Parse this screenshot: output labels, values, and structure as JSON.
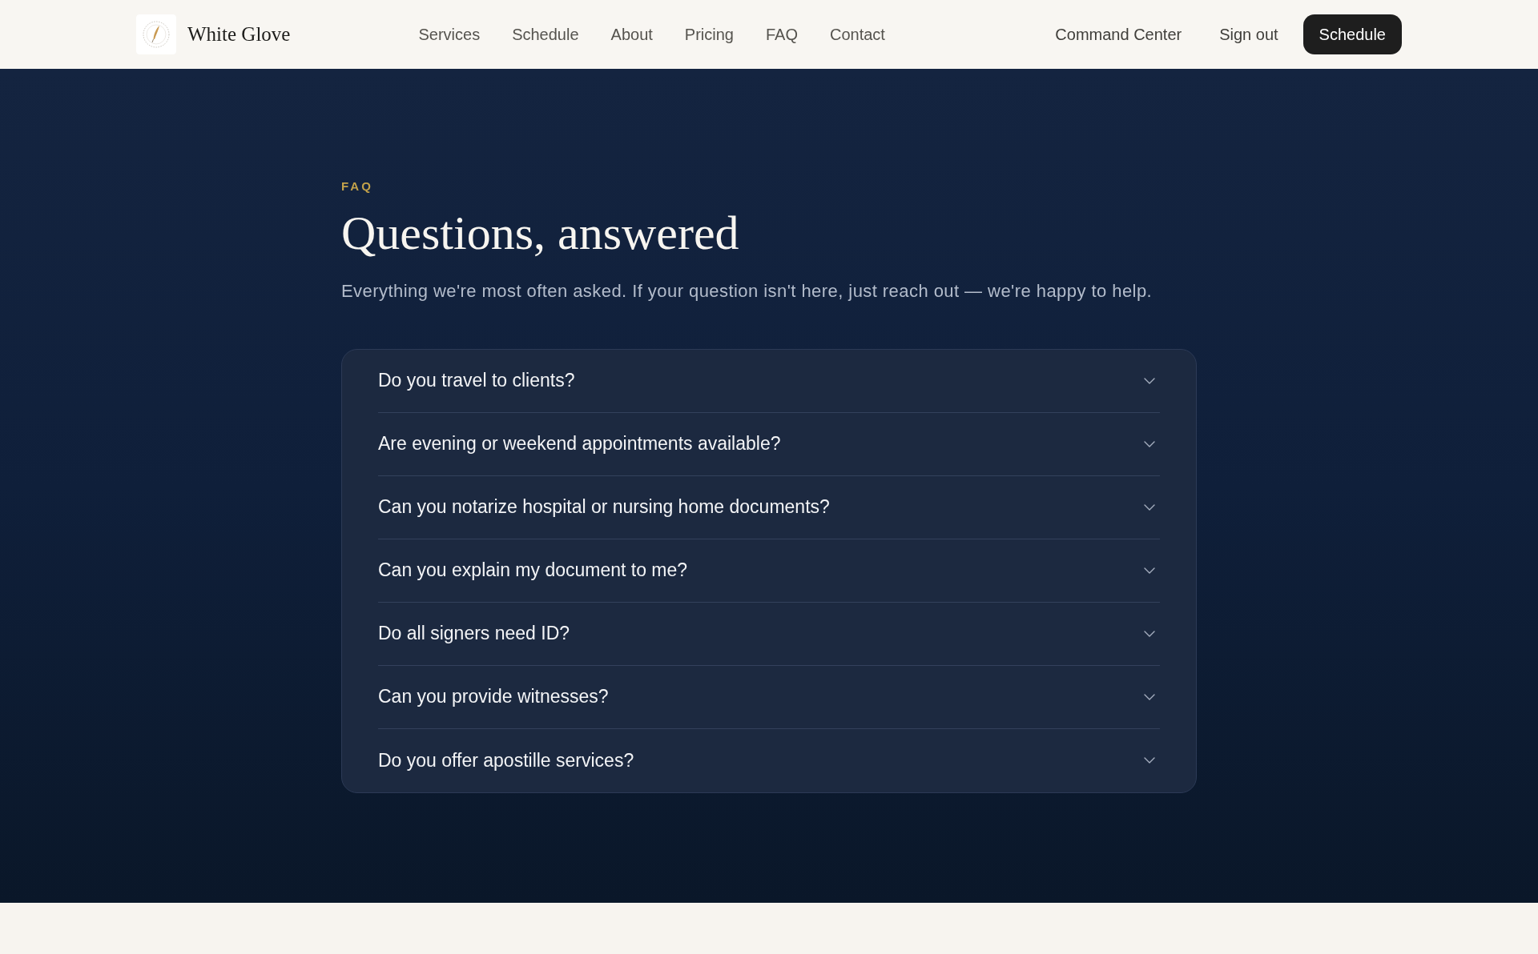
{
  "header": {
    "brand": "White Glove",
    "nav": [
      "Services",
      "Schedule",
      "About",
      "Pricing",
      "FAQ",
      "Contact"
    ],
    "actions": [
      {
        "label": "Command Center",
        "kind": "link"
      },
      {
        "label": "Sign out",
        "kind": "link"
      },
      {
        "label": "Schedule",
        "kind": "button"
      }
    ]
  },
  "faq": {
    "eyebrow": "FAQ",
    "title": "Questions, answered",
    "subtitle": "Everything we're most often asked. If your question isn't here, just reach out — we're happy to help.",
    "items": [
      {
        "question": "Do you travel to clients?",
        "expanded": false
      },
      {
        "question": "Are evening or weekend appointments available?",
        "expanded": false
      },
      {
        "question": "Can you notarize hospital or nursing home documents?",
        "expanded": false
      },
      {
        "question": "Can you explain my document to me?",
        "expanded": false
      },
      {
        "question": "Do all signers need ID?",
        "expanded": false
      },
      {
        "question": "Can you provide witnesses?",
        "expanded": false
      },
      {
        "question": "Do you offer apostille services?",
        "expanded": false
      }
    ]
  }
}
